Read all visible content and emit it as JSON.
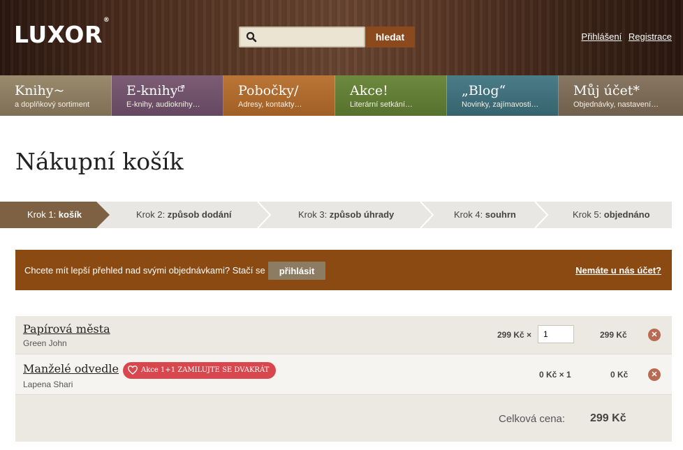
{
  "header": {
    "logo": "LUXOR",
    "logo_mark": "®",
    "search_placeholder": "",
    "search_button": "hledat",
    "login": "Přihlášení",
    "register": "Registrace"
  },
  "nav": [
    {
      "title": "Knihy~",
      "subtitle": "a doplňkový sortiment",
      "color": "#8a7a5e"
    },
    {
      "title": "E-knihy",
      "subtitle": "E-knihy, audioknihy…",
      "color": "#6f4f68"
    },
    {
      "title": "Pobočky/",
      "subtitle": "Adresy, kontakty…",
      "color": "#b06a2e"
    },
    {
      "title": "Akce!",
      "subtitle": "Literární setkání…",
      "color": "#5f7a35"
    },
    {
      "title": "„Blog“",
      "subtitle": "Novinky, zajímavosti…",
      "color": "#3f6f7a"
    },
    {
      "title": "Můj účet*",
      "subtitle": "Objednávky, nastavení…",
      "color": "#7b6a55"
    }
  ],
  "page_title": "Nákupní košík",
  "steps": [
    {
      "prefix": "Krok 1: ",
      "name": "košík",
      "active": true
    },
    {
      "prefix": "Krok 2: ",
      "name": "způsob dodání",
      "active": false
    },
    {
      "prefix": "Krok 3: ",
      "name": "způsob úhrady",
      "active": false
    },
    {
      "prefix": "Krok 4: ",
      "name": "souhrn",
      "active": false
    },
    {
      "prefix": "Krok 5: ",
      "name": "objednáno",
      "active": false
    }
  ],
  "banner": {
    "message": "Chcete mít lepší přehled nad svými objednávkami? Stačí se",
    "login_button": "přihlásit",
    "no_account": "Nemáte u nás účet?"
  },
  "cart": {
    "items": [
      {
        "title": "Papírová města",
        "author": "Green John",
        "unit_price": "299 Kč ×",
        "quantity": "1",
        "total": "299 Kč"
      },
      {
        "title": "Manželé odvedle",
        "author": "Lapena Shari",
        "badge": "Akce 1+1 ZAMILUJTE SE DVAKRÁT",
        "unit_price": "0 Kč × 1",
        "total": "0 Kč"
      }
    ],
    "total_label": "Celková cena:",
    "total_value": "299 Kč"
  },
  "colors": {
    "accent": "#8b4a12",
    "step_active": "#7d6142",
    "remove": "#b86a52",
    "badge": "#d9474e"
  }
}
